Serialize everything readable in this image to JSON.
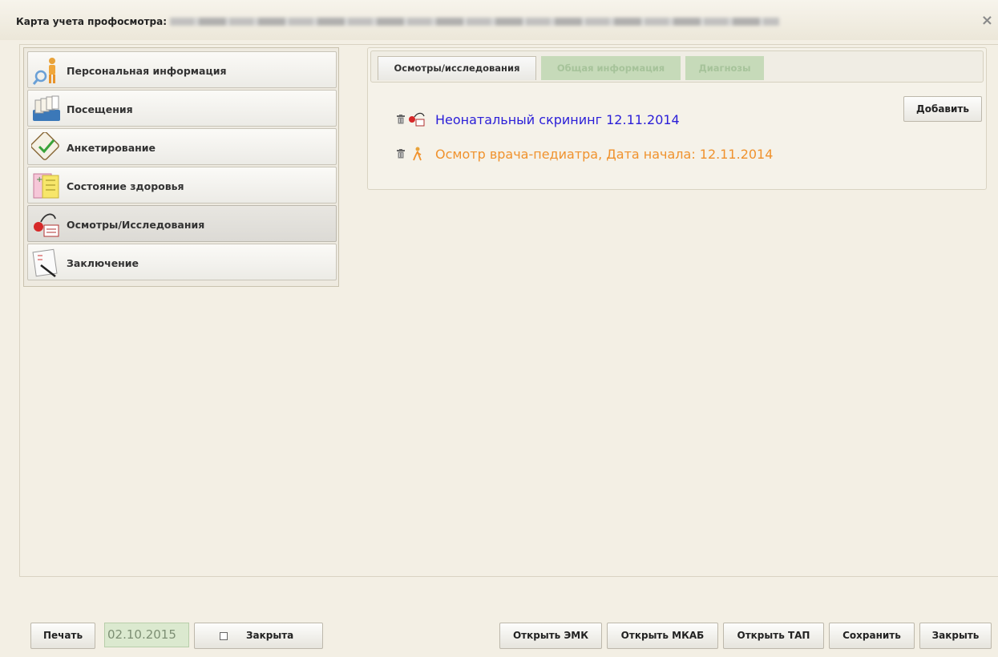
{
  "window": {
    "title": "Карта учета профосмотра:",
    "close_symbol": "×"
  },
  "sidebar": {
    "items": [
      {
        "label": "Персональная информация",
        "icon": "person-search-icon"
      },
      {
        "label": "Посещения",
        "icon": "card-file-icon"
      },
      {
        "label": "Анкетирование",
        "icon": "checkmark-icon"
      },
      {
        "label": "Состояние здоровья",
        "icon": "health-chart-icon"
      },
      {
        "label": "Осмотры/Исследования",
        "icon": "stethoscope-icon",
        "active": true
      },
      {
        "label": "Заключение",
        "icon": "conclusion-pen-icon"
      }
    ]
  },
  "tabs": [
    {
      "label": "Осмотры/исследования",
      "active": true
    },
    {
      "label": "Общая информация",
      "active": false,
      "disabled": true
    },
    {
      "label": "Диагнозы",
      "active": false,
      "disabled": true
    }
  ],
  "content": {
    "add_label": "Добавить",
    "exams": [
      {
        "text": "Неонатальный скрининг 12.11.2014",
        "color": "#2a1ed8",
        "icon": "microscope-icon"
      },
      {
        "text": "Осмотр врача-педиатра, Дата начала: 12.11.2014",
        "color": "#f0922d",
        "icon": "doctor-icon"
      }
    ]
  },
  "footer": {
    "print_label": "Печать",
    "date_value": "02.10.2015",
    "closed_label": "Закрыта",
    "closed_checked": false,
    "open_emk_label": "Открыть ЭМК",
    "open_mkab_label": "Открыть МКАБ",
    "open_tap_label": "Открыть ТАП",
    "save_label": "Сохранить",
    "close_label": "Закрыть"
  }
}
